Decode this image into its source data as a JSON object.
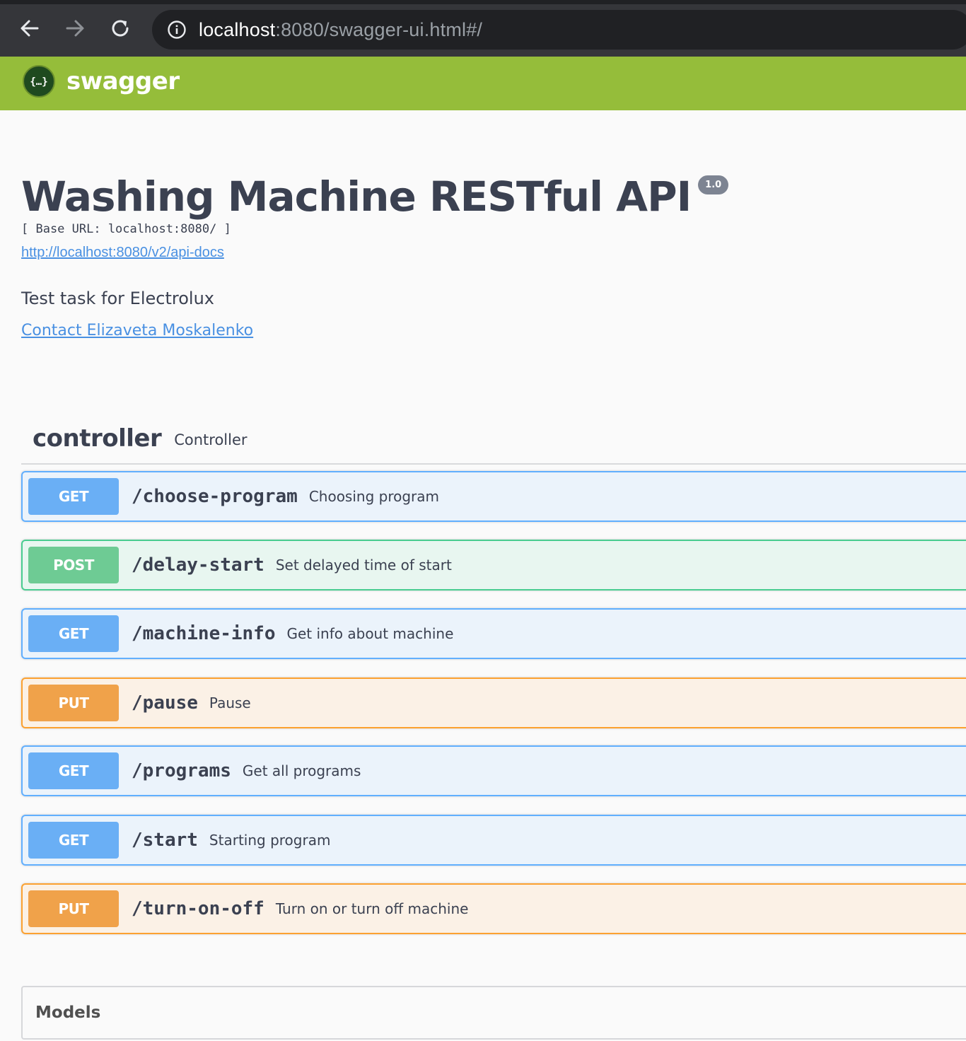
{
  "browser": {
    "url_host": "localhost",
    "url_rest": ":8080/swagger-ui.html#/"
  },
  "topbar": {
    "logo_text": "swagger"
  },
  "info": {
    "title": "Washing Machine RESTful API",
    "version": "1.0",
    "base_url": "[ Base URL: localhost:8080/ ]",
    "api_docs_link": "http://localhost:8080/v2/api-docs",
    "description": "Test task for Electrolux",
    "contact": "Contact Elizaveta Moskalenko"
  },
  "tag": {
    "name": "controller",
    "description": "Controller"
  },
  "operations": [
    {
      "method": "GET",
      "path": "/choose-program",
      "summary": "Choosing program"
    },
    {
      "method": "POST",
      "path": "/delay-start",
      "summary": "Set delayed time of start"
    },
    {
      "method": "GET",
      "path": "/machine-info",
      "summary": "Get info about machine"
    },
    {
      "method": "PUT",
      "path": "/pause",
      "summary": "Pause"
    },
    {
      "method": "GET",
      "path": "/programs",
      "summary": "Get all programs"
    },
    {
      "method": "GET",
      "path": "/start",
      "summary": "Starting program"
    },
    {
      "method": "PUT",
      "path": "/turn-on-off",
      "summary": "Turn on or turn off machine"
    }
  ],
  "models": {
    "title": "Models"
  },
  "icons": {
    "back": "arrow-left-icon",
    "forward": "arrow-right-icon",
    "reload": "reload-icon",
    "site_info": "info-icon",
    "logo": "swagger-logo-icon"
  },
  "colors": {
    "get": "#61affe",
    "post": "#49cc90",
    "put": "#fca130",
    "topbar": "#95bd3a"
  }
}
